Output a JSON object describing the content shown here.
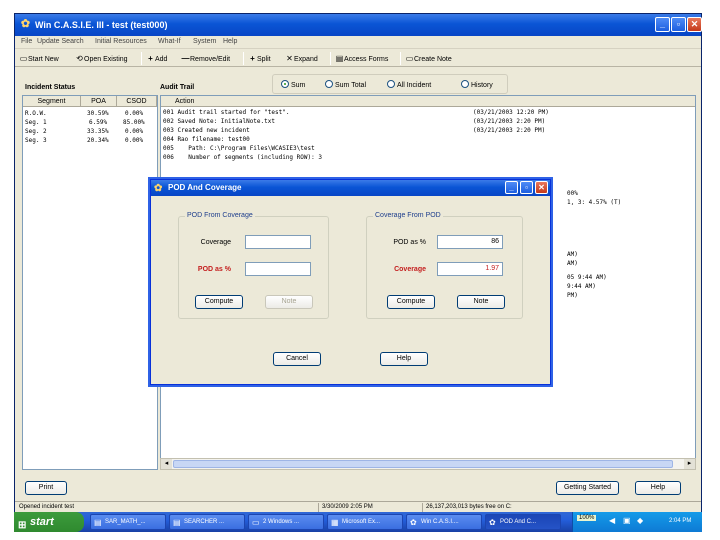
{
  "window": {
    "title": "Win C.A.S.I.E. III - test (test000)",
    "menu": [
      "File",
      "Update Search",
      "Initial Resources",
      "What-If",
      "System",
      "Help"
    ],
    "toolbar": [
      {
        "icon": "new-doc-icon",
        "glyph": "▭",
        "label": "Start New"
      },
      {
        "icon": "open-icon",
        "glyph": "⟲",
        "label": "Open Existing"
      },
      {
        "icon": "plus-icon",
        "glyph": "+",
        "label": "Add"
      },
      {
        "icon": "minus-icon",
        "glyph": "—",
        "label": "Remove/Edit"
      },
      {
        "icon": "split-icon",
        "glyph": "+",
        "label": "Split"
      },
      {
        "icon": "x-icon",
        "glyph": "✕",
        "label": "Expand"
      },
      {
        "icon": "printer-icon",
        "glyph": "▤",
        "label": "Access Forms"
      },
      {
        "icon": "note-icon",
        "glyph": "▭",
        "label": "Create Note"
      }
    ]
  },
  "incident_status": {
    "header": "Incident Status",
    "columns": [
      "Segment",
      "POA",
      "CSOD"
    ],
    "rows": [
      [
        "R.O.W.",
        "30.59%",
        "0.00%"
      ],
      [
        "Seg. 1",
        "6.59%",
        "85.00%"
      ],
      [
        "Seg. 2",
        "33.35%",
        "0.00%"
      ],
      [
        "Seg. 3",
        "20.34%",
        "0.00%"
      ]
    ]
  },
  "audit_trail": {
    "header": "Audit Trail",
    "tabs": [
      "Sum",
      "Sum Total",
      "All Incident",
      "History"
    ],
    "selected_tab": 0,
    "column": "Action",
    "rows": [
      {
        "text": "001 Audit trail started for \"test\".",
        "time": "(03/21/2003 12:20 PM)"
      },
      {
        "text": "002 Saved Note: InitialNote.txt",
        "time": "(03/21/2003 2:20 PM)"
      },
      {
        "text": "003 Created new incident",
        "time": "(03/21/2003 2:20 PM)"
      },
      {
        "text": "004 Rao filename: test00",
        "time": ""
      },
      {
        "text": "005    Path: C:\\Program Files\\WCASIE3\\test",
        "time": ""
      },
      {
        "text": "006    Number of segments (including ROW): 3",
        "time": ""
      }
    ],
    "right_fragments": [
      "00%",
      "1, 3: 4.57% (T)",
      "AM)",
      "AM)",
      "05 9:44 AM)",
      "9:44 AM)",
      "PM)"
    ]
  },
  "buttons": {
    "print": "Print",
    "getting_started": "Getting Started",
    "help": "Help"
  },
  "status_bar": {
    "left": "Opened incident test",
    "middle": "3/30/2009 2:05 PM",
    "right": "26,137,203,013 bytes free on C:"
  },
  "taskbar": {
    "start": "start",
    "tasks": [
      "SAR_MATH_...",
      "SEARCHER ...",
      "2 Windows ...",
      "Microsoft Ex...",
      "Win C.A.S.I....",
      "POD And C..."
    ],
    "tray_zoom": "100%",
    "clock": "2:04 PM"
  },
  "dialog": {
    "title": "POD And Coverage",
    "left_group": {
      "label": "POD From Coverage",
      "coverage_label": "Coverage",
      "coverage_value": "",
      "pod_label": "POD as %",
      "pod_value": "",
      "compute": "Compute",
      "note": "Note"
    },
    "right_group": {
      "label": "Coverage From POD",
      "pod_label": "POD as %",
      "pod_value": "86",
      "coverage_label": "Coverage",
      "coverage_value": "1.97",
      "compute": "Compute",
      "note": "Note"
    },
    "cancel": "Cancel",
    "help": "Help"
  }
}
